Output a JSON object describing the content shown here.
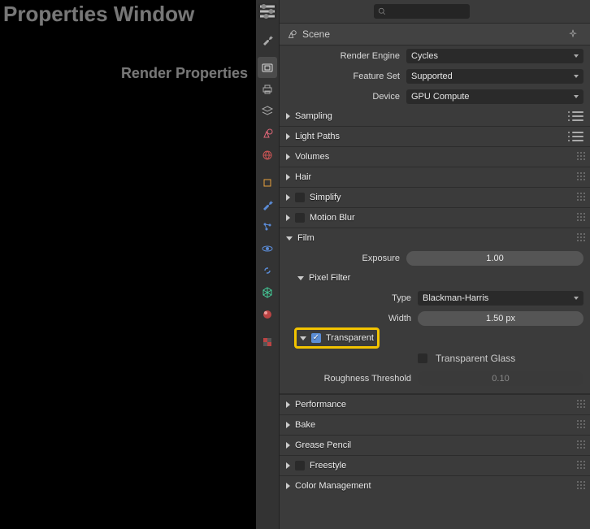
{
  "annotations": {
    "title": "Properties Window",
    "subtitle": "Render Properties"
  },
  "search": {
    "placeholder": ""
  },
  "scene": {
    "label": "Scene"
  },
  "fields": {
    "render_engine": {
      "label": "Render Engine",
      "value": "Cycles"
    },
    "feature_set": {
      "label": "Feature Set",
      "value": "Supported"
    },
    "device": {
      "label": "Device",
      "value": "GPU Compute"
    },
    "exposure": {
      "label": "Exposure",
      "value": "1.00"
    },
    "pf_type": {
      "label": "Type",
      "value": "Blackman-Harris"
    },
    "pf_width": {
      "label": "Width",
      "value": "1.50 px"
    },
    "rough_thresh": {
      "label": "Roughness Threshold",
      "value": "0.10"
    }
  },
  "panels": {
    "sampling": "Sampling",
    "light_paths": "Light Paths",
    "volumes": "Volumes",
    "hair": "Hair",
    "simplify": "Simplify",
    "motion_blur": "Motion Blur",
    "film": "Film",
    "pixel_filter": "Pixel Filter",
    "transparent": "Transparent",
    "transparent_glass": "Transparent Glass",
    "performance": "Performance",
    "bake": "Bake",
    "grease": "Grease Pencil",
    "freestyle": "Freestyle",
    "colorman": "Color Management"
  },
  "tab_icons": [
    "tool",
    "render",
    "output",
    "viewlayer",
    "scene",
    "world",
    "object",
    "modifier",
    "particle",
    "physics",
    "constraint",
    "data",
    "material",
    "texture"
  ]
}
